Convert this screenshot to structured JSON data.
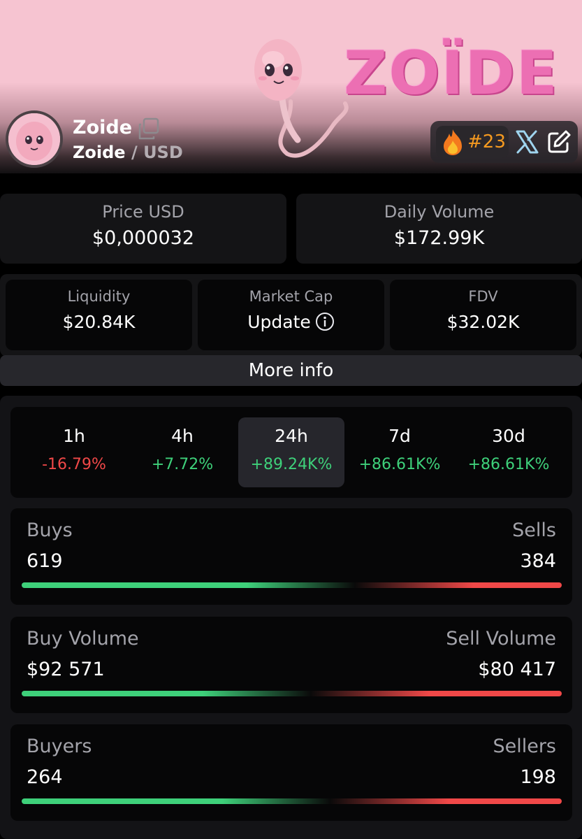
{
  "header": {
    "brand_word": "ZOÏDE",
    "token_name": "Zoide",
    "pair_base": "Zoide",
    "pair_separator": "/",
    "pair_quote": "USD",
    "rank": "#23",
    "icons": [
      "copy-icon",
      "fire-icon",
      "x-logo-icon",
      "edit-icon",
      "info-icon"
    ],
    "colors": {
      "rank": "#f59a20",
      "banner_pink": "#f6c4d1",
      "brand_pink": "#ec6fb3"
    }
  },
  "stats": {
    "price": {
      "label": "Price USD",
      "value": "$0,000032"
    },
    "daily_volume": {
      "label": "Daily Volume",
      "value": "$172.99K"
    },
    "liquidity": {
      "label": "Liquidity",
      "value": "$20.84K"
    },
    "market_cap": {
      "label": "Market Cap",
      "value": "Update"
    },
    "fdv": {
      "label": "FDV",
      "value": "$32.02K"
    }
  },
  "more_info_label": "More info",
  "periods": [
    {
      "label": "1h",
      "change": "-16.79%",
      "trend": "down"
    },
    {
      "label": "4h",
      "change": "+7.72%",
      "trend": "up"
    },
    {
      "label": "24h",
      "change": "+89.24K%",
      "trend": "up",
      "active": true
    },
    {
      "label": "7d",
      "change": "+86.61K%",
      "trend": "up"
    },
    {
      "label": "30d",
      "change": "+86.61K%",
      "trend": "up"
    }
  ],
  "ratios": {
    "txns": {
      "left_label": "Buys",
      "left_value": "619",
      "right_label": "Sells",
      "right_value": "384",
      "buy_share": 0.617
    },
    "volume": {
      "left_label": "Buy Volume",
      "left_value": "$92 571",
      "right_label": "Sell Volume",
      "right_value": "$80 417",
      "buy_share": 0.535
    },
    "makers": {
      "left_label": "Buyers",
      "left_value": "264",
      "right_label": "Sellers",
      "right_value": "198",
      "buy_share": 0.571
    }
  },
  "colors": {
    "positive": "#3ed07a",
    "negative": "#f04848"
  }
}
